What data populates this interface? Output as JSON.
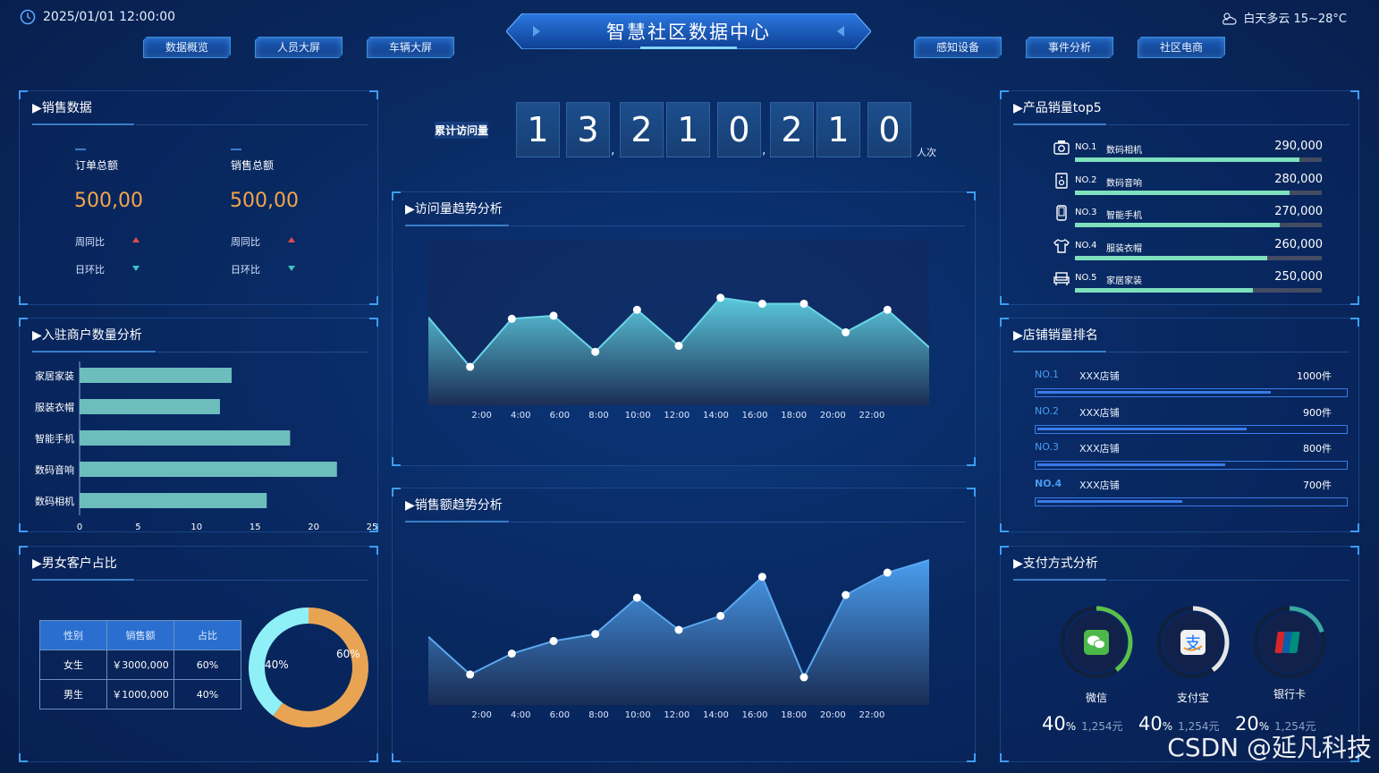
{
  "header": {
    "datetime": "2025/01/01  12:00:00",
    "title": "智慧社区数据中心",
    "weather": "白天多云  15~28°C",
    "nav_left": [
      "数据概览",
      "人员大屏",
      "车辆大屏"
    ],
    "nav_right": [
      "感知设备",
      "事件分析",
      "社区电商"
    ]
  },
  "sales": {
    "title": "▶销售数据",
    "items": [
      {
        "label": "订单总额",
        "value": "500,00",
        "week_label": "周同比",
        "day_label": "日环比"
      },
      {
        "label": "销售总额",
        "value": "500,00",
        "week_label": "周同比",
        "day_label": "日环比"
      }
    ]
  },
  "merchants": {
    "title": "▶入驻商户数量分析",
    "chart_data": {
      "type": "bar",
      "orientation": "horizontal",
      "categories": [
        "家居家装",
        "服装衣帽",
        "智能手机",
        "数码音响",
        "数码相机"
      ],
      "values": [
        13,
        12,
        18,
        22,
        16
      ],
      "xlim": [
        0,
        25
      ],
      "xticks": [
        "0",
        "5",
        "10",
        "15",
        "20",
        "25"
      ],
      "color": "#6dbdbd"
    }
  },
  "gender": {
    "title": "▶男女客户占比",
    "headers": [
      "性别",
      "销售额",
      "占比"
    ],
    "rows": [
      [
        "女生",
        "￥3000,000",
        "60%"
      ],
      [
        "男生",
        "￥1000,000",
        "40%"
      ]
    ],
    "chart_data": {
      "type": "pie",
      "slices": [
        {
          "label": "60%",
          "value": 60,
          "color": "#e8a453"
        },
        {
          "label": "40%",
          "value": 40,
          "color": "#8ff0f7"
        }
      ]
    }
  },
  "visits": {
    "label": "累计访问量",
    "digits": [
      "1",
      "3",
      "2",
      "1",
      "0",
      "2",
      "1",
      "0"
    ],
    "unit": "人次"
  },
  "visit_trend": {
    "title": "▶访问量趋势分析",
    "chart_data": {
      "type": "area",
      "x": [
        "",
        "2:00",
        "4:00",
        "6:00",
        "8:00",
        "10:00",
        "12:00",
        "14:00",
        "16:00",
        "18:00",
        "20:00",
        "22:00",
        ""
      ],
      "xticks": [
        "2:00",
        "4:00",
        "6:00",
        "8:00",
        "10:00",
        "12:00",
        "14:00",
        "16:00",
        "18:00",
        "20:00",
        "22:00"
      ],
      "values": [
        55,
        22,
        54,
        56,
        32,
        60,
        36,
        68,
        64,
        64,
        45,
        60,
        35
      ],
      "ylim": [
        0,
        100
      ],
      "line_color": "#6ad6e8"
    }
  },
  "sales_trend": {
    "title": "▶销售额趋势分析",
    "chart_data": {
      "type": "area",
      "xticks": [
        "2:00",
        "4:00",
        "6:00",
        "8:00",
        "10:00",
        "12:00",
        "14:00",
        "16:00",
        "18:00",
        "20:00",
        "22:00"
      ],
      "values": [
        45,
        18,
        33,
        42,
        47,
        73,
        50,
        60,
        88,
        16,
        75,
        91,
        100
      ],
      "ylim": [
        0,
        100
      ],
      "line_color": "#5aa8ee"
    }
  },
  "top5": {
    "title": "▶产品销量top5",
    "items": [
      {
        "rank": "NO.1",
        "name": "数码相机",
        "value": "290,000",
        "ratio": 0.91,
        "icon": "camera-icon"
      },
      {
        "rank": "NO.2",
        "name": "数码音响",
        "value": "280,000",
        "ratio": 0.87,
        "icon": "speaker-icon"
      },
      {
        "rank": "NO.3",
        "name": "智能手机",
        "value": "270,000",
        "ratio": 0.83,
        "icon": "phone-icon"
      },
      {
        "rank": "NO.4",
        "name": "服装衣帽",
        "value": "260,000",
        "ratio": 0.78,
        "icon": "shirt-icon"
      },
      {
        "rank": "NO.5",
        "name": "家居家装",
        "value": "250,000",
        "ratio": 0.72,
        "icon": "sofa-icon"
      }
    ]
  },
  "shops": {
    "title": "▶店铺销量排名",
    "items": [
      {
        "rank": "NO.1",
        "name": "XXX店铺",
        "value": "1000件",
        "ratio": 0.76
      },
      {
        "rank": "NO.2",
        "name": "XXX店铺",
        "value": "900件",
        "ratio": 0.68
      },
      {
        "rank": "NO.3",
        "name": "XXX店铺",
        "value": "800件",
        "ratio": 0.61
      },
      {
        "rank": "NO.4",
        "name": "XXX店铺",
        "value": "700件",
        "ratio": 0.47
      }
    ]
  },
  "payment": {
    "title": "▶支付方式分析",
    "items": [
      {
        "name": "微信",
        "pct": "40",
        "amount": "1,254元",
        "ratio": 0.4,
        "color": "#5cc04a",
        "icon": "wechat-icon"
      },
      {
        "name": "支付宝",
        "pct": "40",
        "amount": "1,254元",
        "ratio": 0.4,
        "color": "#e6e6e6",
        "icon": "alipay-icon"
      },
      {
        "name": "银行卡",
        "pct": "20",
        "amount": "1,254元",
        "ratio": 0.2,
        "color": "#3aa7a0",
        "icon": "unionpay-icon"
      }
    ],
    "pct_unit": "%"
  },
  "watermark": "CSDN @延凡科技"
}
